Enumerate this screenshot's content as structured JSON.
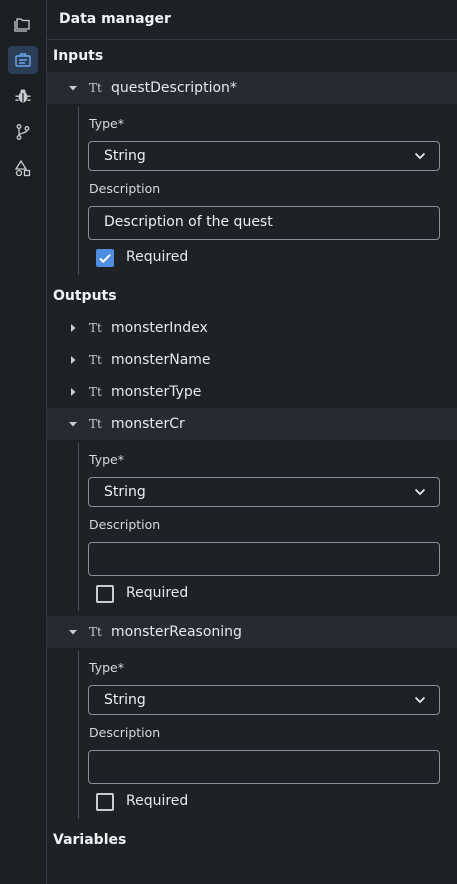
{
  "panel": {
    "title": "Data manager"
  },
  "activity": [
    {
      "name": "explorer",
      "icon": "files-icon"
    },
    {
      "name": "data-manager",
      "icon": "briefcase-icon",
      "active": true
    },
    {
      "name": "debug",
      "icon": "bug-icon"
    },
    {
      "name": "source-control",
      "icon": "branch-icon"
    },
    {
      "name": "shapes",
      "icon": "shapes-icon"
    }
  ],
  "type_icon": "Tt",
  "inputs": {
    "label": "Inputs",
    "items": [
      {
        "name": "questDescription*",
        "type_label": "Type*",
        "type_value": "String",
        "description_label": "Description",
        "description_value": "Description of the quest",
        "required_label": "Required",
        "required": true
      }
    ]
  },
  "outputs": {
    "label": "Outputs",
    "collapsed": [
      "monsterIndex",
      "monsterName",
      "monsterType"
    ],
    "expanded": [
      {
        "name": "monsterCr",
        "type_label": "Type*",
        "type_value": "String",
        "description_label": "Description",
        "description_value": "",
        "required_label": "Required",
        "required": false
      },
      {
        "name": "monsterReasoning",
        "type_label": "Type*",
        "type_value": "String",
        "description_label": "Description",
        "description_value": "",
        "required_label": "Required",
        "required": false
      }
    ]
  },
  "variables": {
    "label": "Variables"
  },
  "colors": {
    "accent": "#4d8ee0",
    "background": "#1e2227",
    "row_open": "#262b31"
  }
}
